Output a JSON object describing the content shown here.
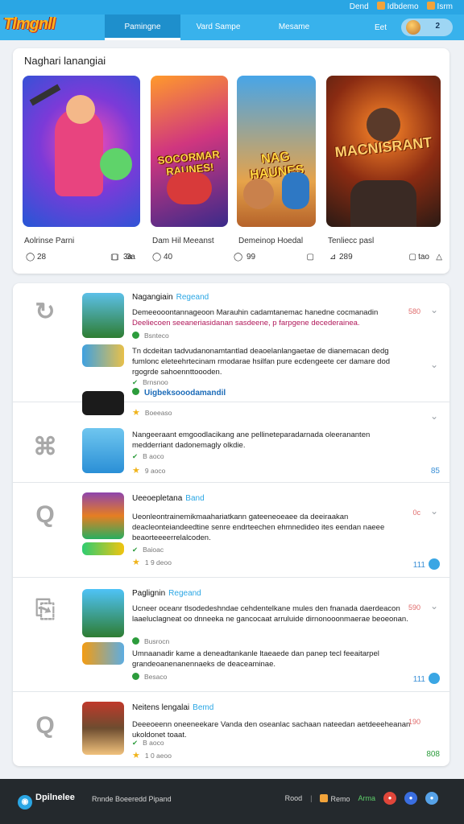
{
  "header": {
    "logo": "Tlmgnll",
    "top_links": [
      "Dend",
      "Idbdemo",
      "Isrm"
    ],
    "tabs": [
      {
        "label": "Pamingne",
        "active": true
      },
      {
        "label": "Vard Sampe",
        "active": false
      },
      {
        "label": "Mesame",
        "active": false
      }
    ],
    "extra": "Eet",
    "profile_count": "2"
  },
  "featured": {
    "title": "Naghari lanangiai",
    "games": [
      {
        "art_text": "",
        "name": "Aolrinse Parni",
        "left_stat": "28",
        "right_stat": "3a"
      },
      {
        "art_text": "SOCORMAR RAUNES!",
        "name": "Dam Hil Meeanst",
        "left_stat": "40",
        "right_stat": ""
      },
      {
        "art_text": "NAG HAUNES",
        "name": "Demeinop Hoedal",
        "left_stat": "99",
        "right_stat": ""
      },
      {
        "art_text": "MACNISRANT",
        "name": "Tenliecc pasl",
        "left_stat": "289",
        "right_stat": "tao"
      }
    ]
  },
  "list": {
    "rows": [
      {
        "title": "Nagangiain",
        "tag": "Regeand",
        "desc1_a": "Demeeooontannageoon Marauhin cadamtanemac hanedne cocmanadin",
        "desc1_b": "Deeliecoen seeaneriasidanan sasdeene, p farpgene decederainea.",
        "meta1": "Bsnteco",
        "desc2": "Tn dcdeitan tadvudanonamtantlad deaoelanlangaetae de dianemacan dedg fumlonc eleteehrtecinam rmodarae hsilfan pure ecdengeete cer damare dod rgogrde sahoennttoooden.",
        "meta2": "Brnsnoo",
        "link": "Uigbeksooodamandil",
        "meta3": "Boeeaso",
        "num": "580"
      },
      {
        "title": "",
        "tag": "",
        "desc1_a": "Nangeeraant emgoodlacikang ane pellineteparadarnada oleerananten medderriant dadonemagly olkdie.",
        "desc1_b": "",
        "meta1": "9 aoco",
        "desc2": "",
        "meta2": "",
        "link": "",
        "meta3": "",
        "num": "",
        "count": "85"
      },
      {
        "title": "Ueeoepletana",
        "tag": "Band",
        "desc1_a": "Ueonleontrainemikmaahariatkann gateeneoeaee da deeiraakan deacleonteiandeedtine senre endrteechen ehmnedideo ites eendan naeee beaorteeeerrelalcoden.",
        "desc1_b": "",
        "meta1": "Baioac",
        "desc2": "",
        "meta2": "",
        "link": "",
        "meta3": "1 9 deoo",
        "num": "0c",
        "count": "111"
      },
      {
        "title": "Paglignin",
        "tag": "Regeand",
        "desc1_a": "Ucneer oceanr tlsodedeshndae cehdentelkane mules den fnanada daerdeacon laaeluclagneat oo dnneeka ne gancocaat arruluide dirnonooonmaerae beoeonan.",
        "desc1_b": "",
        "meta1": "Busrocn",
        "desc2": "Umnaanadir kame a deneadtankanle ltaeaede dan panep tecl feeaitarpel grandeoanenanennaeks de deaceaminae.",
        "meta2": "Besaco",
        "link": "",
        "meta3": "",
        "num": "590",
        "count": "111"
      },
      {
        "title": "Neitens lengalai",
        "tag": "Bemd",
        "desc1_a": "Deeeoeenn oneeneekare Vanda den oseanlac sachaan nateedan aetdeeeheanan ukoldonet toaat.",
        "desc1_b": "",
        "meta1": "1 0 aeoo",
        "desc2": "",
        "meta2": "",
        "link": "",
        "meta3": "",
        "num": "190",
        "count": "808"
      }
    ]
  },
  "footer": {
    "brand": "Dpilnelee",
    "middle": "Rnnde Boeeredd Pipand",
    "links": [
      "Rood",
      "Remo",
      "Arma"
    ]
  }
}
